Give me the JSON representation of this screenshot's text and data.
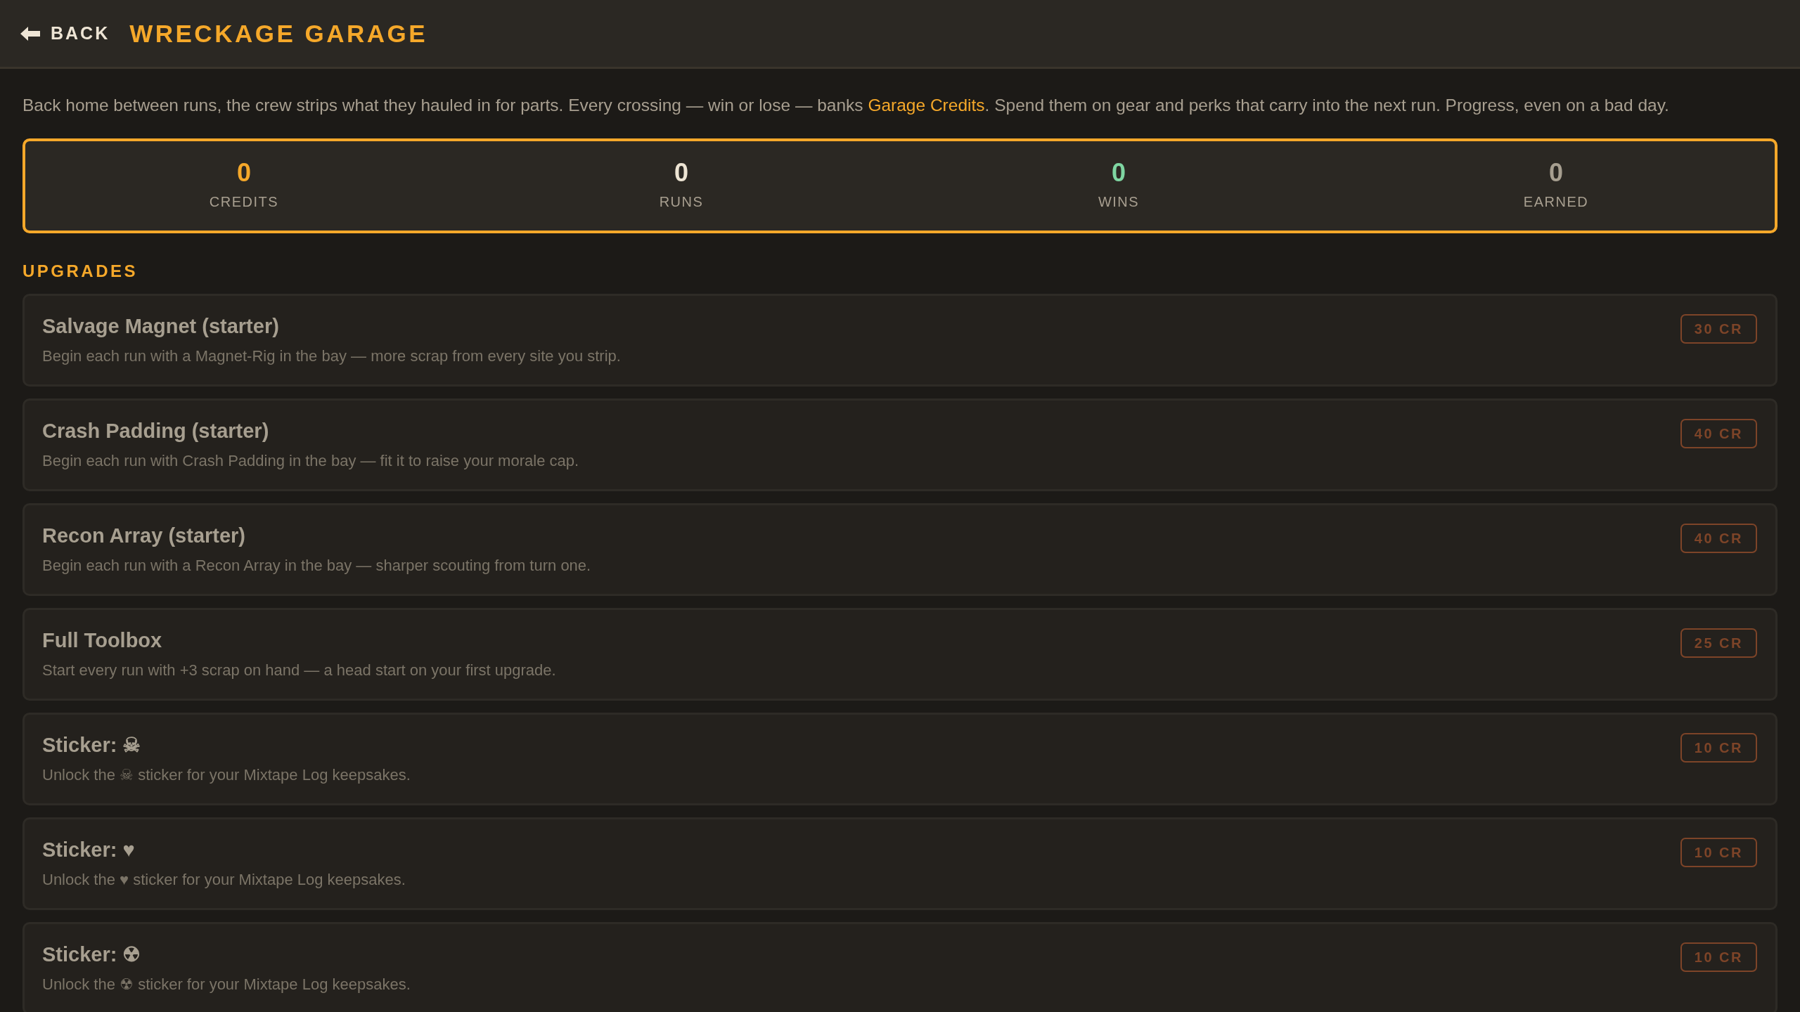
{
  "header": {
    "back_label": "BACK",
    "title": "WRECKAGE GARAGE"
  },
  "intro": {
    "before": "Back home between runs, the crew strips what they hauled in for parts. Every crossing — win or lose — banks ",
    "link": "Garage Credits",
    "after": ". Spend them on gear and perks that carry into the next run. Progress, even on a bad day."
  },
  "stats": [
    {
      "value": "0",
      "label": "CREDITS",
      "color": "#f5a82a"
    },
    {
      "value": "0",
      "label": "RUNS",
      "color": "#ede4d3"
    },
    {
      "value": "0",
      "label": "WINS",
      "color": "#7fd6a2"
    },
    {
      "value": "0",
      "label": "EARNED",
      "color": "#a79f90"
    }
  ],
  "section_title": "UPGRADES",
  "upgrades": [
    {
      "title": "Salvage Magnet (starter)",
      "description": "Begin each run with a Magnet-Rig in the bay — more scrap from every site you strip.",
      "price": "30 CR",
      "affordable": false
    },
    {
      "title": "Crash Padding (starter)",
      "description": "Begin each run with Crash Padding in the bay — fit it to raise your morale cap.",
      "price": "40 CR",
      "affordable": false
    },
    {
      "title": "Recon Array (starter)",
      "description": "Begin each run with a Recon Array in the bay — sharper scouting from turn one.",
      "price": "40 CR",
      "affordable": false
    },
    {
      "title": "Full Toolbox",
      "description": "Start every run with +3 scrap on hand — a head start on your first upgrade.",
      "price": "25 CR",
      "affordable": false
    },
    {
      "title": "Sticker: ☠",
      "description": "Unlock the ☠ sticker for your Mixtape Log keepsakes.",
      "price": "10 CR",
      "affordable": false
    },
    {
      "title": "Sticker: ♥",
      "description": "Unlock the ♥ sticker for your Mixtape Log keepsakes.",
      "price": "10 CR",
      "affordable": false
    },
    {
      "title": "Sticker: ☢",
      "description": "Unlock the ☢ sticker for your Mixtape Log keepsakes.",
      "price": "10 CR",
      "affordable": false
    }
  ]
}
